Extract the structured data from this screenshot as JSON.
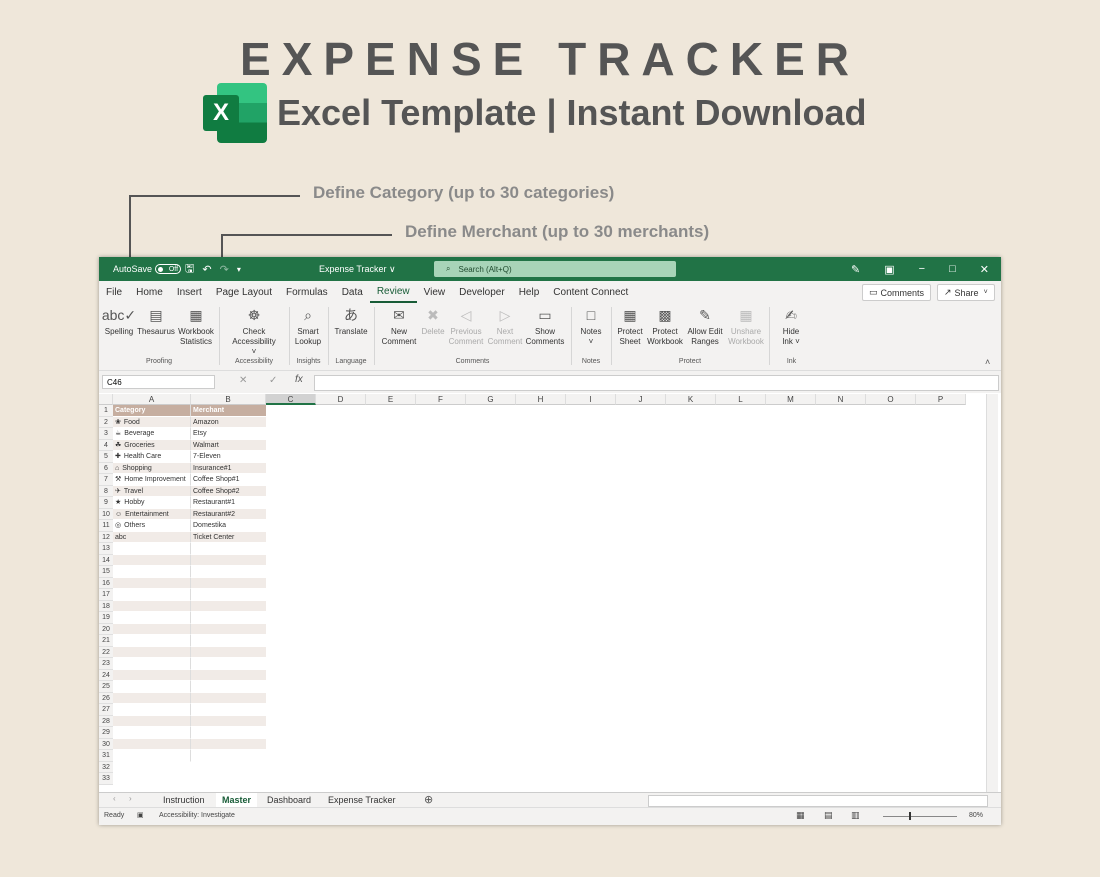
{
  "hero": {
    "title": "EXPENSE TRACKER",
    "subtitle": "Excel Template | Instant Download",
    "logo_letter": "X"
  },
  "callouts": {
    "category": "Define Category  (up to 30 categories)",
    "merchant": "Define Merchant  (up to 30 merchants)"
  },
  "window": {
    "autosave_label": "AutoSave",
    "autosave_state": "Off",
    "title": "Expense Tracker ∨",
    "search_placeholder": "Search (Alt+Q)",
    "tabs": [
      "File",
      "Home",
      "Insert",
      "Page Layout",
      "Formulas",
      "Data",
      "Review",
      "View",
      "Developer",
      "Help",
      "Content Connect"
    ],
    "active_tab": "Review",
    "comments_label": "Comments",
    "share_label": "Share",
    "ribbon": [
      {
        "label": "Spelling",
        "icon": "abc✓",
        "dis": false
      },
      {
        "label": "Thesaurus",
        "icon": "▤",
        "dis": false
      },
      {
        "label": "Workbook\nStatistics",
        "icon": "▦",
        "dis": false
      },
      {
        "label": "Check\nAccessibility ˅",
        "icon": "☸",
        "dis": false
      },
      {
        "label": "Smart\nLookup",
        "icon": "⌕",
        "dis": false
      },
      {
        "label": "Translate",
        "icon": "あ",
        "dis": false
      },
      {
        "label": "New\nComment",
        "icon": "✉",
        "dis": false
      },
      {
        "label": "Delete",
        "icon": "✖",
        "dis": true
      },
      {
        "label": "Previous\nComment",
        "icon": "◁",
        "dis": true
      },
      {
        "label": "Next\nComment",
        "icon": "▷",
        "dis": true
      },
      {
        "label": "Show\nComments",
        "icon": "▭",
        "dis": false
      },
      {
        "label": "Notes\n˅",
        "icon": "□",
        "dis": false
      },
      {
        "label": "Protect\nSheet",
        "icon": "▦",
        "dis": false
      },
      {
        "label": "Protect\nWorkbook",
        "icon": "▩",
        "dis": false
      },
      {
        "label": "Allow Edit\nRanges",
        "icon": "✎",
        "dis": false
      },
      {
        "label": "Unshare\nWorkbook",
        "icon": "▦",
        "dis": true
      },
      {
        "label": "Hide\nInk ˅",
        "icon": "✍",
        "dis": false
      }
    ],
    "groups": [
      "Proofing",
      "Accessibility",
      "Insights",
      "Language",
      "Comments",
      "Notes",
      "Protect",
      "Ink"
    ],
    "name_box": "C46",
    "fx_label": "fx",
    "columns": [
      "A",
      "B",
      "C",
      "D",
      "E",
      "F",
      "G",
      "H",
      "I",
      "J",
      "K",
      "L",
      "M",
      "N",
      "O",
      "P"
    ],
    "headers": {
      "category": "Category",
      "merchant": "Merchant"
    },
    "categories": [
      "Food",
      "Beverage",
      "Groceries",
      "Health Care",
      "Shopping",
      "Home Improvement",
      "Travel",
      "Hobby",
      "Entertainment",
      "Others",
      "abc"
    ],
    "category_icons": [
      "❀",
      "☕",
      "☘",
      "✚",
      "⌂",
      "⚒",
      "✈",
      "★",
      "☺",
      "◎",
      ""
    ],
    "merchants": [
      "Amazon",
      "Etsy",
      "Walmart",
      "7-Eleven",
      "Insurance#1",
      "Coffee Shop#1",
      "Coffee Shop#2",
      "Restaurant#1",
      "Restaurant#2",
      "Domestika",
      "Ticket Center"
    ],
    "row_count": 33,
    "sheets": [
      "Instruction",
      "Master",
      "Dashboard",
      "Expense Tracker"
    ],
    "active_sheet": "Master",
    "status": {
      "ready": "Ready",
      "accessibility": "Accessibility: Investigate",
      "zoom": "80%"
    }
  }
}
